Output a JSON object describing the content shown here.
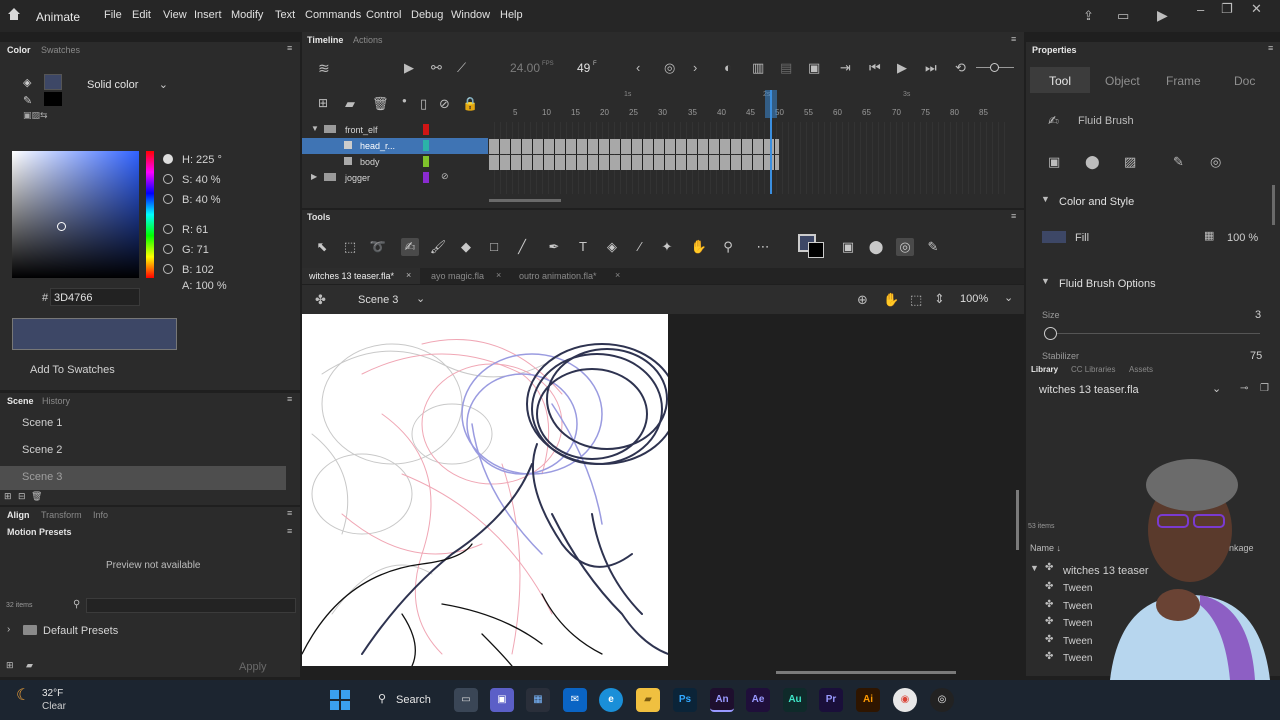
{
  "app": {
    "name": "Animate",
    "menu": [
      "File",
      "Edit",
      "View",
      "Insert",
      "Modify",
      "Text",
      "Commands",
      "Control",
      "Debug",
      "Window",
      "Help"
    ]
  },
  "color_panel": {
    "tabs": [
      "Color",
      "Swatches"
    ],
    "fill_type": "Solid color",
    "hsb": {
      "h": "H: 225 °",
      "s": "S: 40 %",
      "b": "B: 40 %"
    },
    "rgb": {
      "r": "R: 61",
      "g": "G: 71",
      "b": "B: 102"
    },
    "alpha": "A: 100 %",
    "hex_label": "#",
    "hex": "3D4766",
    "add_swatch": "Add To Swatches",
    "swatch_color": "#3D4766"
  },
  "scene_panel": {
    "tabs": [
      "Scene",
      "History"
    ],
    "scenes": [
      "Scene 1",
      "Scene 2",
      "Scene 3"
    ],
    "selected": "Scene 3"
  },
  "align_panel": {
    "tabs": [
      "Align",
      "Transform",
      "Info"
    ],
    "motion_presets": "Motion Presets",
    "preview": "Preview not available",
    "count": "32 items",
    "folder": "Default Presets",
    "apply": "Apply"
  },
  "timeline": {
    "tabs": [
      "Timeline",
      "Actions"
    ],
    "fps": "24.00",
    "fps_unit": "FPS",
    "frame": "49",
    "frame_unit": "F",
    "layers": [
      {
        "name": "front_elf",
        "color": "#d01515",
        "selected": false
      },
      {
        "name": "head_r...",
        "color": "#2bb3a8",
        "selected": true
      },
      {
        "name": "body",
        "color": "#7fc22b",
        "selected": false
      },
      {
        "name": "jogger",
        "color": "#8a2bd0",
        "selected": false
      }
    ],
    "ruler": [
      "5",
      "10",
      "15",
      "20",
      "25",
      "30",
      "35",
      "40",
      "45",
      "50",
      "55",
      "60",
      "65",
      "70",
      "75",
      "80",
      "85"
    ],
    "seconds": [
      "1s",
      "2s",
      "3s"
    ]
  },
  "tools_panel": {
    "title": "Tools"
  },
  "documents": {
    "tabs": [
      "witches 13 teaser.fla*",
      "ayo magic.fla",
      "outro animation.fla*"
    ],
    "scene": "Scene 3",
    "zoom": "100%"
  },
  "properties": {
    "title": "Properties",
    "tabs": [
      "Tool",
      "Object",
      "Frame",
      "Doc"
    ],
    "tool_name": "Fluid Brush",
    "color_style": "Color and Style",
    "fill_label": "Fill",
    "fill_alpha": "100 %",
    "fluid_options": "Fluid Brush Options",
    "size_label": "Size",
    "size_value": "3",
    "stabilizer_label": "Stabilizer",
    "stabilizer_value": "75"
  },
  "library": {
    "tabs": [
      "Library",
      "CC Libraries",
      "Assets"
    ],
    "file": "witches 13 teaser.fla",
    "count": "53 items",
    "col_name": "Name",
    "col_linkage": "Linkage",
    "items": [
      "witches 13 teaser",
      "Tween",
      "Tween",
      "Tween",
      "Tween",
      "Tween"
    ]
  },
  "taskbar": {
    "temp": "32°F",
    "weather": "Clear",
    "search": "Search",
    "apps": [
      "Ps",
      "An",
      "Ae",
      "Au",
      "Pr",
      "Ai"
    ]
  }
}
